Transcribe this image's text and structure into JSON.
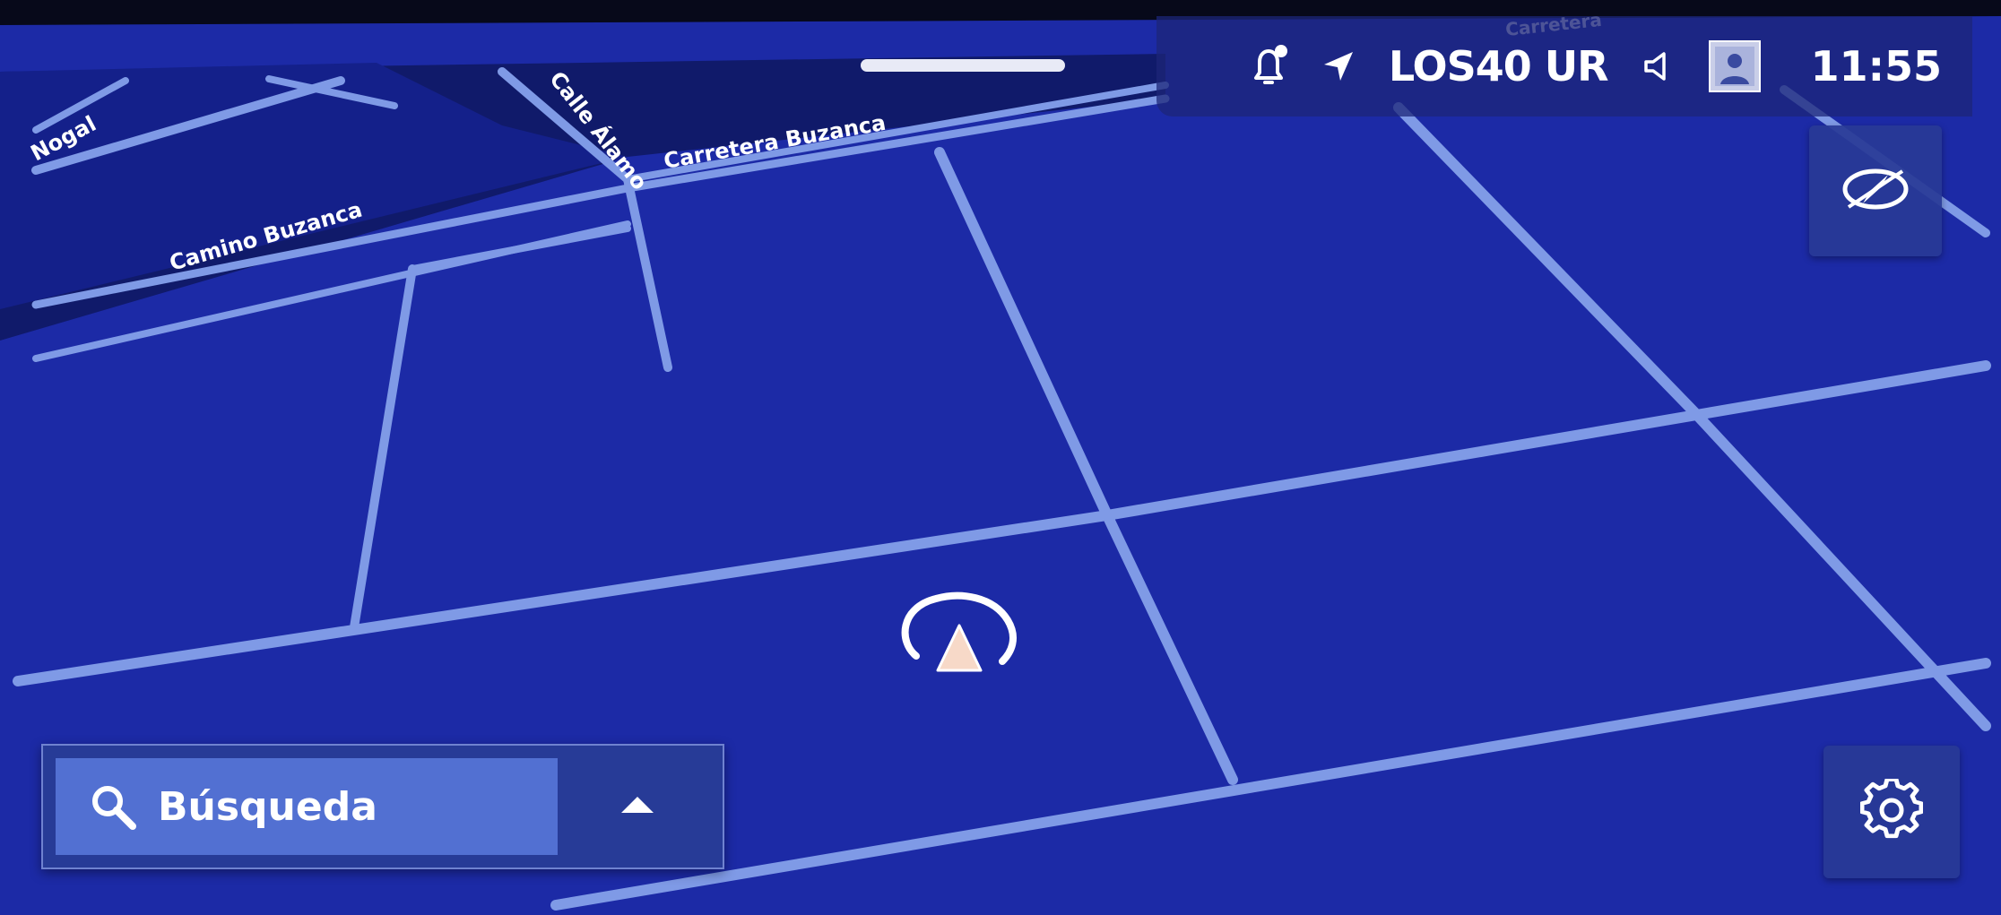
{
  "app": {
    "screen": "navigation-map"
  },
  "status_bar": {
    "radio_station": "LOS40 UR",
    "time": "11:55",
    "icons": [
      "notification-bell-icon",
      "location-arrow-icon",
      "volume-speaker-icon",
      "user-profile-icon"
    ]
  },
  "map": {
    "theme_colors": {
      "background": "#1c2aa6",
      "road": "#7f9ae6",
      "dark_area": "#101a6a"
    },
    "street_labels": {
      "nogal": "Nogal",
      "calle_alamo": "Calle Álamo",
      "carretera_buzanca": "Carretera Buzanca",
      "camino_buzanca": "Camino Buzanca",
      "carretera_top": "Carretera"
    }
  },
  "controls": {
    "compass_icon": "compass-eye-icon",
    "settings_icon": "gear-icon",
    "vehicle_marker": "vehicle-position-arrow"
  },
  "search": {
    "label": "Búsqueda",
    "icon": "search-icon",
    "expand_icon": "triangle-up-icon"
  }
}
